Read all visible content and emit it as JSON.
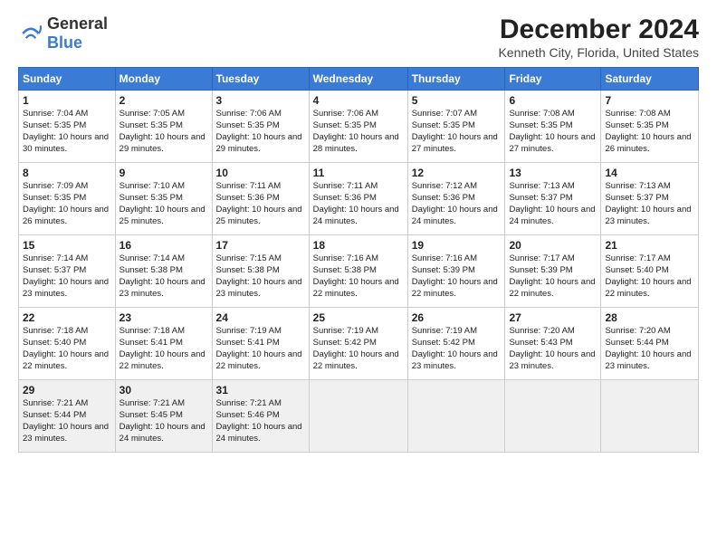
{
  "logo": {
    "general": "General",
    "blue": "Blue"
  },
  "title": "December 2024",
  "subtitle": "Kenneth City, Florida, United States",
  "days_of_week": [
    "Sunday",
    "Monday",
    "Tuesday",
    "Wednesday",
    "Thursday",
    "Friday",
    "Saturday"
  ],
  "weeks": [
    [
      {
        "day": "1",
        "sunrise": "Sunrise: 7:04 AM",
        "sunset": "Sunset: 5:35 PM",
        "daylight": "Daylight: 10 hours and 30 minutes."
      },
      {
        "day": "2",
        "sunrise": "Sunrise: 7:05 AM",
        "sunset": "Sunset: 5:35 PM",
        "daylight": "Daylight: 10 hours and 29 minutes."
      },
      {
        "day": "3",
        "sunrise": "Sunrise: 7:06 AM",
        "sunset": "Sunset: 5:35 PM",
        "daylight": "Daylight: 10 hours and 29 minutes."
      },
      {
        "day": "4",
        "sunrise": "Sunrise: 7:06 AM",
        "sunset": "Sunset: 5:35 PM",
        "daylight": "Daylight: 10 hours and 28 minutes."
      },
      {
        "day": "5",
        "sunrise": "Sunrise: 7:07 AM",
        "sunset": "Sunset: 5:35 PM",
        "daylight": "Daylight: 10 hours and 27 minutes."
      },
      {
        "day": "6",
        "sunrise": "Sunrise: 7:08 AM",
        "sunset": "Sunset: 5:35 PM",
        "daylight": "Daylight: 10 hours and 27 minutes."
      },
      {
        "day": "7",
        "sunrise": "Sunrise: 7:08 AM",
        "sunset": "Sunset: 5:35 PM",
        "daylight": "Daylight: 10 hours and 26 minutes."
      }
    ],
    [
      {
        "day": "8",
        "sunrise": "Sunrise: 7:09 AM",
        "sunset": "Sunset: 5:35 PM",
        "daylight": "Daylight: 10 hours and 26 minutes."
      },
      {
        "day": "9",
        "sunrise": "Sunrise: 7:10 AM",
        "sunset": "Sunset: 5:35 PM",
        "daylight": "Daylight: 10 hours and 25 minutes."
      },
      {
        "day": "10",
        "sunrise": "Sunrise: 7:11 AM",
        "sunset": "Sunset: 5:36 PM",
        "daylight": "Daylight: 10 hours and 25 minutes."
      },
      {
        "day": "11",
        "sunrise": "Sunrise: 7:11 AM",
        "sunset": "Sunset: 5:36 PM",
        "daylight": "Daylight: 10 hours and 24 minutes."
      },
      {
        "day": "12",
        "sunrise": "Sunrise: 7:12 AM",
        "sunset": "Sunset: 5:36 PM",
        "daylight": "Daylight: 10 hours and 24 minutes."
      },
      {
        "day": "13",
        "sunrise": "Sunrise: 7:13 AM",
        "sunset": "Sunset: 5:37 PM",
        "daylight": "Daylight: 10 hours and 24 minutes."
      },
      {
        "day": "14",
        "sunrise": "Sunrise: 7:13 AM",
        "sunset": "Sunset: 5:37 PM",
        "daylight": "Daylight: 10 hours and 23 minutes."
      }
    ],
    [
      {
        "day": "15",
        "sunrise": "Sunrise: 7:14 AM",
        "sunset": "Sunset: 5:37 PM",
        "daylight": "Daylight: 10 hours and 23 minutes."
      },
      {
        "day": "16",
        "sunrise": "Sunrise: 7:14 AM",
        "sunset": "Sunset: 5:38 PM",
        "daylight": "Daylight: 10 hours and 23 minutes."
      },
      {
        "day": "17",
        "sunrise": "Sunrise: 7:15 AM",
        "sunset": "Sunset: 5:38 PM",
        "daylight": "Daylight: 10 hours and 23 minutes."
      },
      {
        "day": "18",
        "sunrise": "Sunrise: 7:16 AM",
        "sunset": "Sunset: 5:38 PM",
        "daylight": "Daylight: 10 hours and 22 minutes."
      },
      {
        "day": "19",
        "sunrise": "Sunrise: 7:16 AM",
        "sunset": "Sunset: 5:39 PM",
        "daylight": "Daylight: 10 hours and 22 minutes."
      },
      {
        "day": "20",
        "sunrise": "Sunrise: 7:17 AM",
        "sunset": "Sunset: 5:39 PM",
        "daylight": "Daylight: 10 hours and 22 minutes."
      },
      {
        "day": "21",
        "sunrise": "Sunrise: 7:17 AM",
        "sunset": "Sunset: 5:40 PM",
        "daylight": "Daylight: 10 hours and 22 minutes."
      }
    ],
    [
      {
        "day": "22",
        "sunrise": "Sunrise: 7:18 AM",
        "sunset": "Sunset: 5:40 PM",
        "daylight": "Daylight: 10 hours and 22 minutes."
      },
      {
        "day": "23",
        "sunrise": "Sunrise: 7:18 AM",
        "sunset": "Sunset: 5:41 PM",
        "daylight": "Daylight: 10 hours and 22 minutes."
      },
      {
        "day": "24",
        "sunrise": "Sunrise: 7:19 AM",
        "sunset": "Sunset: 5:41 PM",
        "daylight": "Daylight: 10 hours and 22 minutes."
      },
      {
        "day": "25",
        "sunrise": "Sunrise: 7:19 AM",
        "sunset": "Sunset: 5:42 PM",
        "daylight": "Daylight: 10 hours and 22 minutes."
      },
      {
        "day": "26",
        "sunrise": "Sunrise: 7:19 AM",
        "sunset": "Sunset: 5:42 PM",
        "daylight": "Daylight: 10 hours and 23 minutes."
      },
      {
        "day": "27",
        "sunrise": "Sunrise: 7:20 AM",
        "sunset": "Sunset: 5:43 PM",
        "daylight": "Daylight: 10 hours and 23 minutes."
      },
      {
        "day": "28",
        "sunrise": "Sunrise: 7:20 AM",
        "sunset": "Sunset: 5:44 PM",
        "daylight": "Daylight: 10 hours and 23 minutes."
      }
    ],
    [
      {
        "day": "29",
        "sunrise": "Sunrise: 7:21 AM",
        "sunset": "Sunset: 5:44 PM",
        "daylight": "Daylight: 10 hours and 23 minutes."
      },
      {
        "day": "30",
        "sunrise": "Sunrise: 7:21 AM",
        "sunset": "Sunset: 5:45 PM",
        "daylight": "Daylight: 10 hours and 24 minutes."
      },
      {
        "day": "31",
        "sunrise": "Sunrise: 7:21 AM",
        "sunset": "Sunset: 5:46 PM",
        "daylight": "Daylight: 10 hours and 24 minutes."
      },
      null,
      null,
      null,
      null
    ]
  ]
}
